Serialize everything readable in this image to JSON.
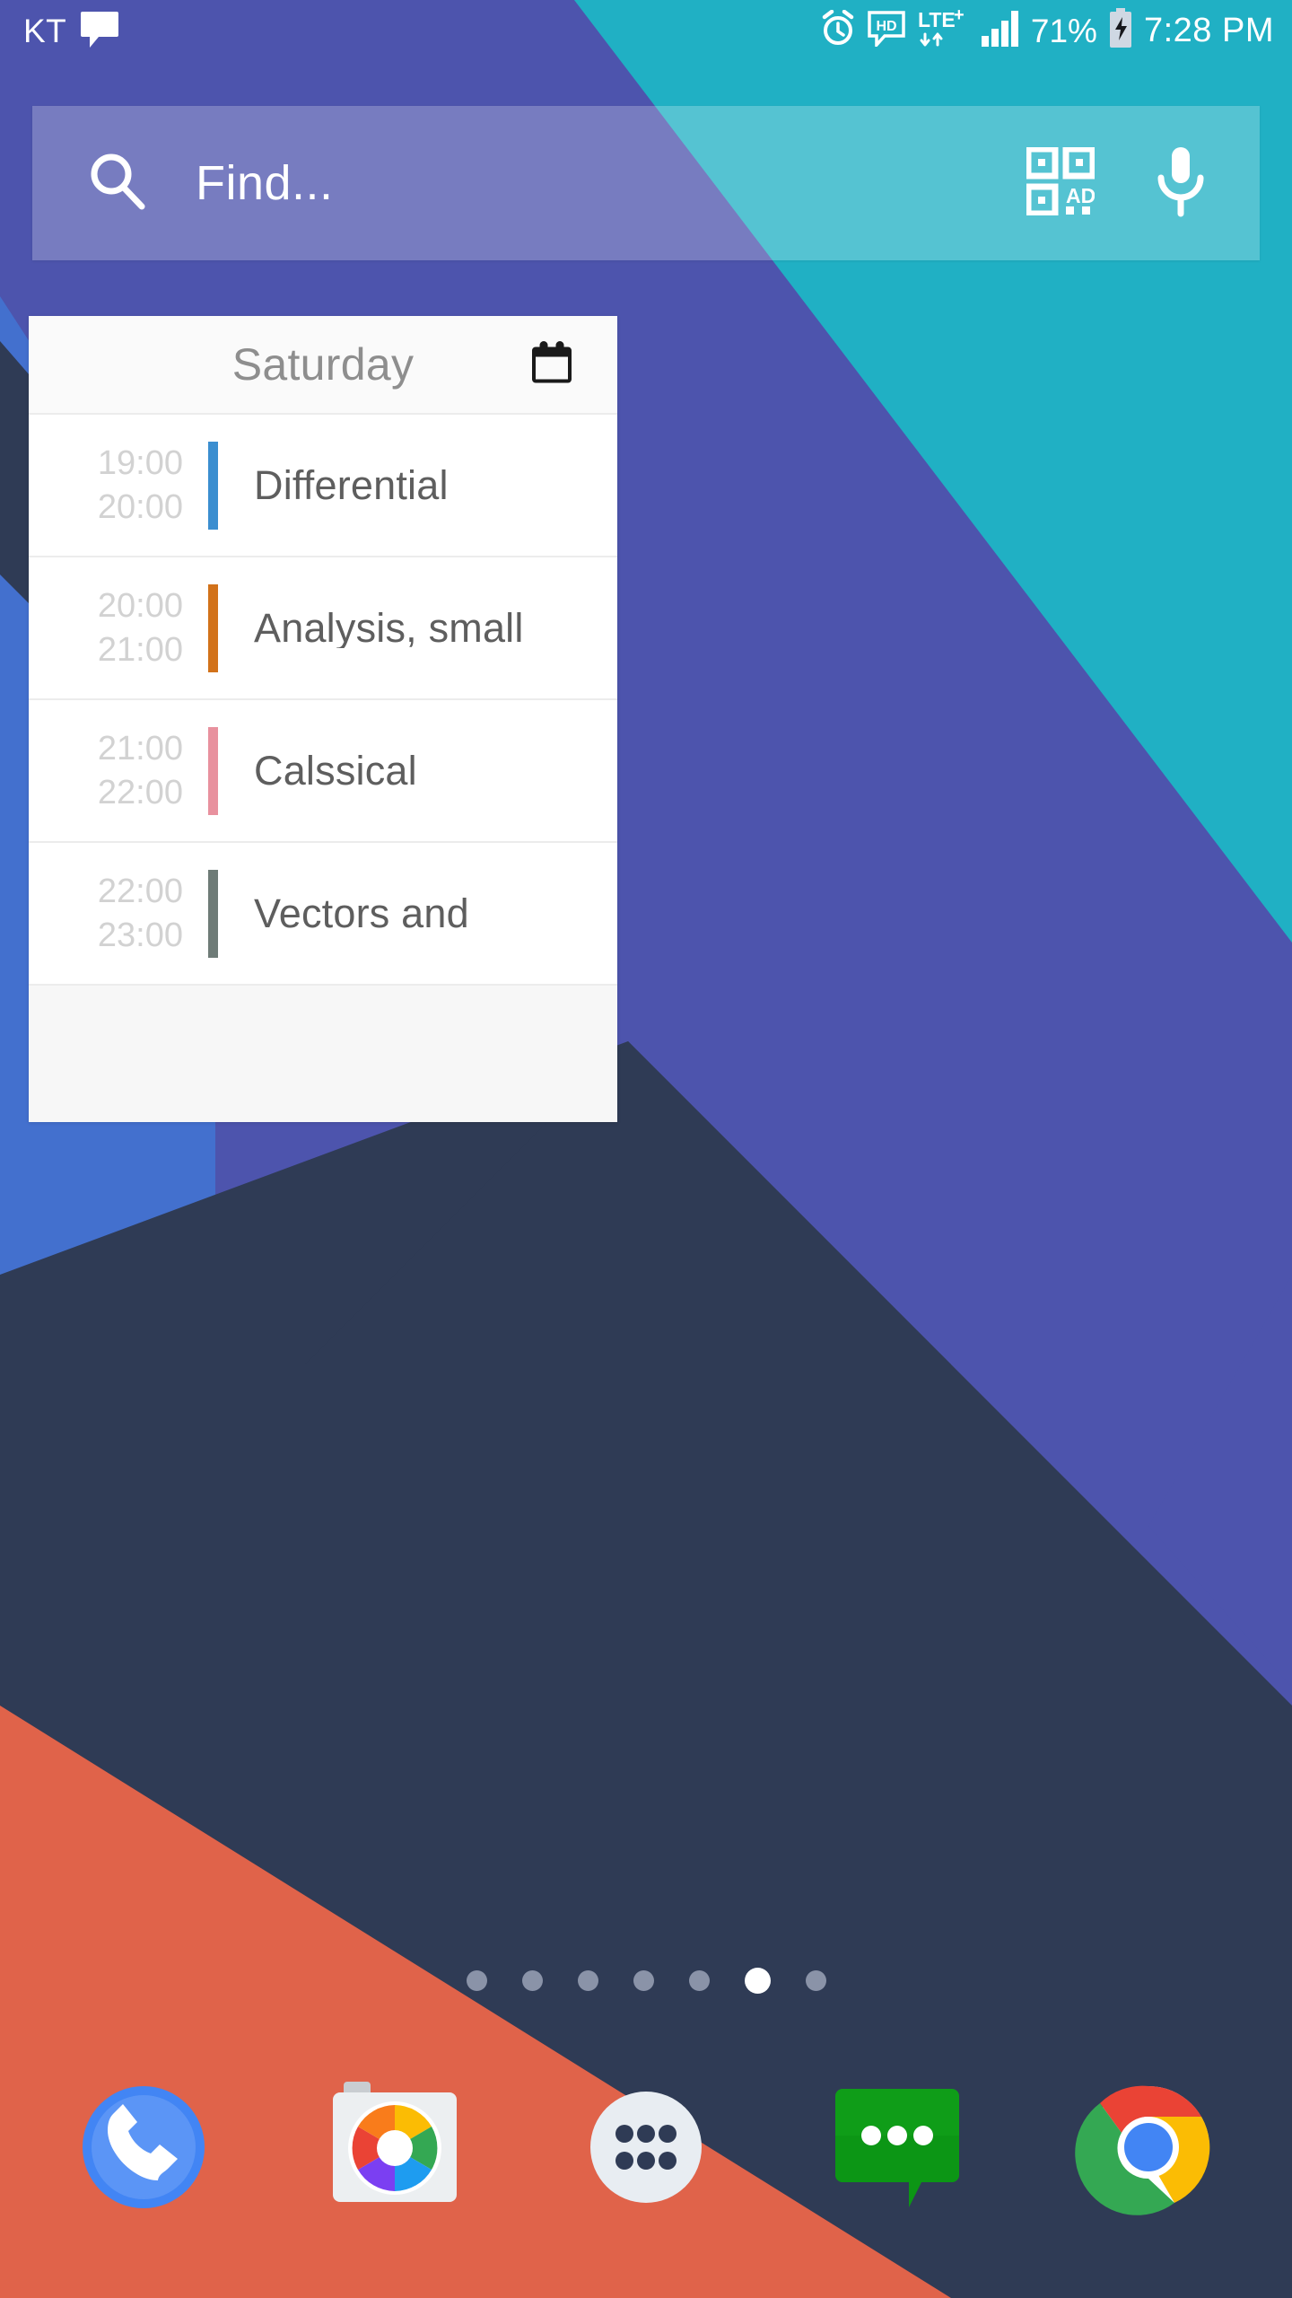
{
  "status_bar": {
    "carrier": "KT",
    "notification_icon": "message-bubble-icon",
    "icons": [
      "alarm-icon",
      "hd-call-icon",
      "lte-plus-icon",
      "signal-bars-icon"
    ],
    "network_label": "LTE",
    "network_superscript": "+",
    "hd_label": "HD",
    "battery_percent": "71%",
    "battery_state": "charging",
    "time": "7:28 PM"
  },
  "search": {
    "placeholder": "Find...",
    "search_icon": "search-icon",
    "qr_icon": "qr-scanner-icon",
    "qr_label": "AD",
    "mic_icon": "microphone-icon"
  },
  "calendar_widget": {
    "title": "Saturday",
    "header_icon": "calendar-icon",
    "events": [
      {
        "start": "19:00",
        "end": "20:00",
        "title": "Differential",
        "color": "#3b8ed0"
      },
      {
        "start": "20:00",
        "end": "21:00",
        "title": "Analysis, small",
        "color": "#d2721a"
      },
      {
        "start": "21:00",
        "end": "22:00",
        "title": "Calssical",
        "color": "#e8919e"
      },
      {
        "start": "22:00",
        "end": "23:00",
        "title": "Vectors and",
        "color": "#6e7b77"
      }
    ]
  },
  "page_indicator": {
    "total": 7,
    "active_index": 5,
    "inactive_color": "#8a93a8",
    "active_color": "#ffffff"
  },
  "dock": {
    "items": [
      {
        "name": "phone",
        "label": "Phone",
        "icon": "phone-icon"
      },
      {
        "name": "camera",
        "label": "Camera",
        "icon": "camera-icon"
      },
      {
        "name": "app-drawer",
        "label": "All apps",
        "icon": "apps-grid-icon"
      },
      {
        "name": "messages",
        "label": "Messages",
        "icon": "messages-icon"
      },
      {
        "name": "chrome",
        "label": "Chrome",
        "icon": "chrome-icon"
      }
    ]
  },
  "wallpaper": {
    "colors": {
      "purple": "#4a4fa8",
      "purple_light": "#4d63c6",
      "blue": "#4370ce",
      "teal": "#20b0c4",
      "navy": "#2f3b55",
      "coral": "#e0634a"
    }
  }
}
